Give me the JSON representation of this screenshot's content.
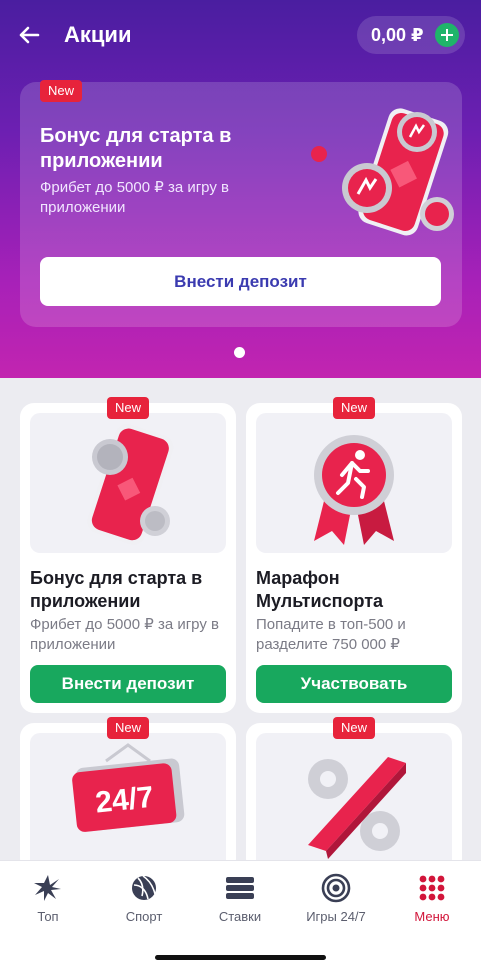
{
  "header": {
    "title": "Акции",
    "balance": "0,00 ₽"
  },
  "promo_banner": {
    "badge": "New",
    "title": "Бонус для старта в приложении",
    "subtitle": "Фрибет до 5000 ₽ за игру в приложении",
    "button_label": "Внести депозит"
  },
  "cards": [
    {
      "badge": "New",
      "title": "Бонус для старта в приложении",
      "subtitle": "Фрибет до 5000 ₽ за игру в приложении",
      "button_label": "Внести депозит"
    },
    {
      "badge": "New",
      "title": "Марафон Мультиспорта",
      "subtitle": "Попадите в топ-500 и разделите 750 000 ₽",
      "button_label": "Участвовать"
    },
    {
      "badge": "New",
      "image_text": "24/7"
    },
    {
      "badge": "New"
    }
  ],
  "tabbar": {
    "items": [
      {
        "label": "Топ",
        "icon": "star-burst-icon"
      },
      {
        "label": "Спорт",
        "icon": "ball-icon"
      },
      {
        "label": "Ставки",
        "icon": "coupon-icon"
      },
      {
        "label": "Игры 24/7",
        "icon": "target-icon"
      },
      {
        "label": "Меню",
        "icon": "grid-dots-icon"
      }
    ],
    "active": "Меню"
  },
  "colors": {
    "accent_green": "#18a85e",
    "badge_red": "#e7233b",
    "active_tab": "#d2153a"
  }
}
